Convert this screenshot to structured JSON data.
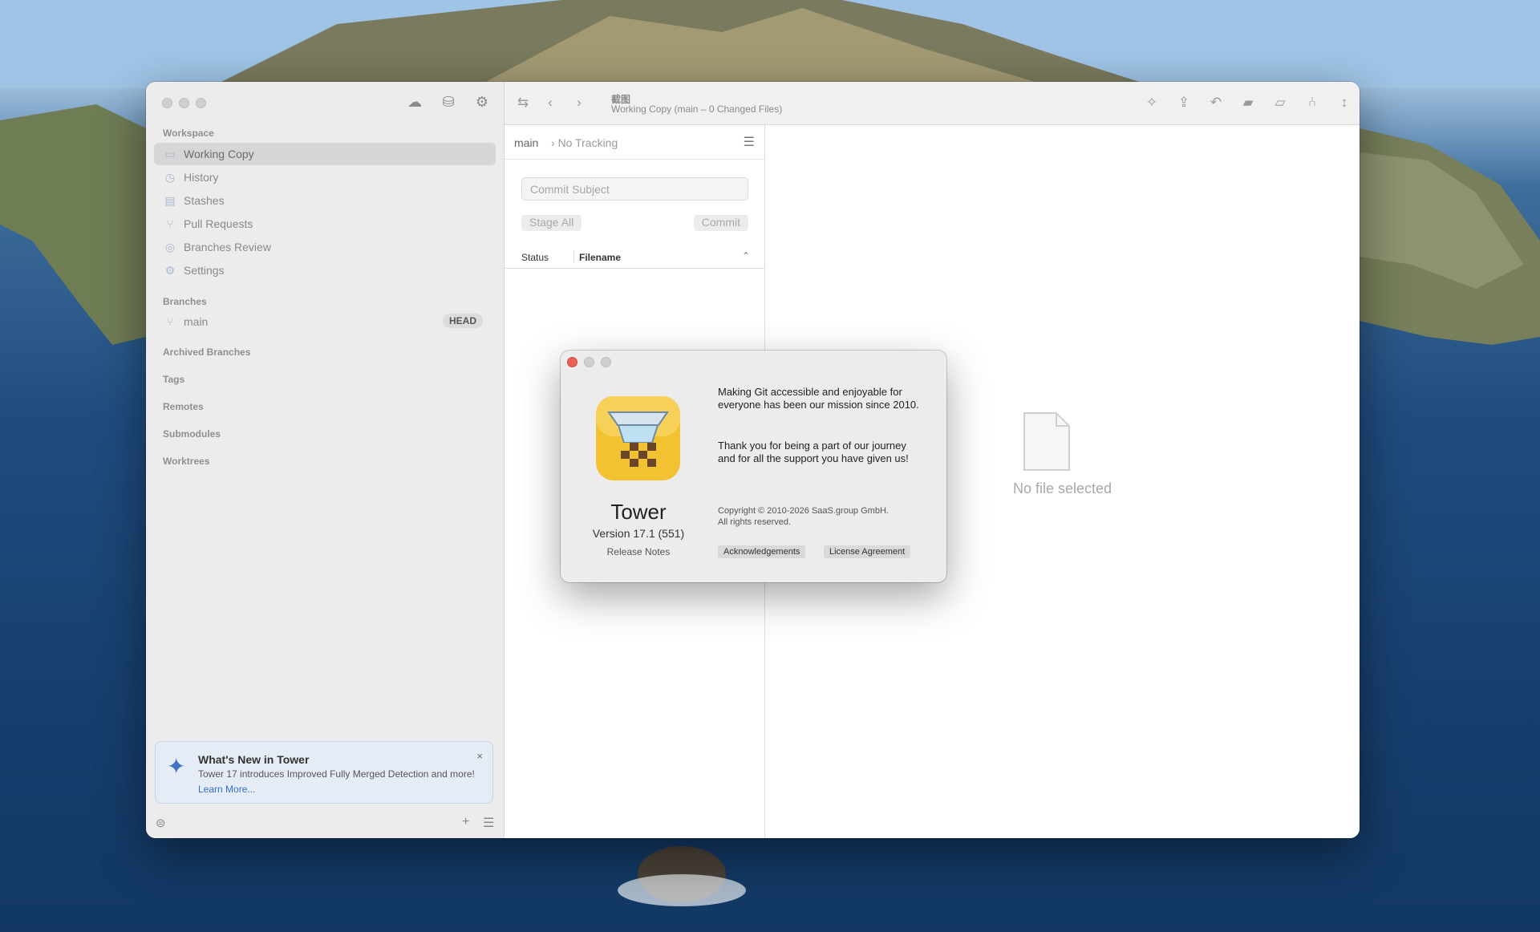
{
  "sidebar": {
    "workspace_header": "Workspace",
    "items": [
      {
        "label": "Working Copy",
        "icon": "folder-icon"
      },
      {
        "label": "History",
        "icon": "clock-icon"
      },
      {
        "label": "Stashes",
        "icon": "stash-icon"
      },
      {
        "label": "Pull Requests",
        "icon": "pull-request-icon"
      },
      {
        "label": "Branches Review",
        "icon": "branches-review-icon"
      },
      {
        "label": "Settings",
        "icon": "gear-icon"
      }
    ],
    "branches_header": "Branches",
    "branch": {
      "label": "main",
      "badge": "HEAD"
    },
    "archived_header": "Archived Branches",
    "tags_header": "Tags",
    "remotes_header": "Remotes",
    "submodules_header": "Submodules",
    "worktrees_header": "Worktrees",
    "whats_new": {
      "title": "What's New in Tower",
      "description": "Tower 17 introduces Improved Fully Merged Detection and more!",
      "link": "Learn More...",
      "close": "×"
    }
  },
  "toolbar": {
    "title": "截图",
    "subtitle": "Working Copy (main – 0 Changed Files)"
  },
  "commit_pane": {
    "branch": "main",
    "tracking": "No Tracking",
    "commit_placeholder": "Commit Subject",
    "stage_all": "Stage All",
    "commit": "Commit",
    "col_status": "Status",
    "col_filename": "Filename"
  },
  "diff_pane": {
    "empty_text": "No file selected"
  },
  "about": {
    "app_name": "Tower",
    "version": "Version 17.1 (551)",
    "release_notes": "Release Notes",
    "mission": "Making Git accessible and enjoyable for everyone has been our mission since 2010.",
    "thanks": "Thank you for being a part of our journey and for all the support you have given us!",
    "copyright": "Copyright © 2010-2026 SaaS.group GmbH.",
    "rights": "All rights reserved.",
    "ack_button": "Acknowledgements",
    "license_button": "License Agreement"
  },
  "colors": {
    "close_red": "#ec5f57",
    "accent_blue": "#2f6fd1",
    "icon_yellow": "#f3c232"
  }
}
